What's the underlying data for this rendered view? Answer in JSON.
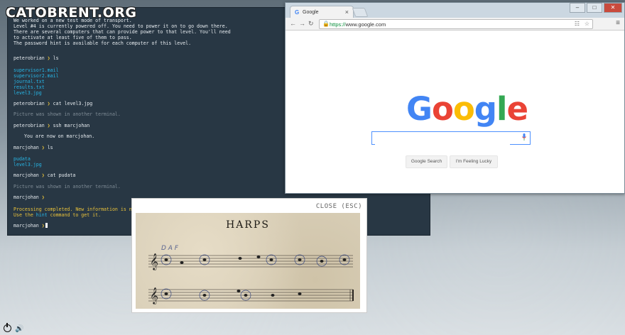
{
  "logo": "CATOBRENT.ORG",
  "terminal": {
    "lines": [
      {
        "text": "We worked on a new test mode of transport.",
        "cls": ""
      },
      {
        "text": "Level #4 is currently powered off. You need to power it on to go down there.",
        "cls": ""
      },
      {
        "text": "There are several computers that can provide power to that level. You'll need",
        "cls": ""
      },
      {
        "text": "to activate at least five of them to pass.",
        "cls": ""
      },
      {
        "text": "The password hint is available for each computer of this level.",
        "cls": ""
      }
    ],
    "prompt1": {
      "user": "peterobrian",
      "cmd": "ls"
    },
    "files1": [
      "supervisor1.mail",
      "supervisor2.mail",
      "journal.txt",
      "results.txt",
      "level3.jpg"
    ],
    "prompt2": {
      "user": "peterobrian",
      "cmd": "cat level3.jpg"
    },
    "msg_shown1": "Picture was shown in another terminal.",
    "prompt3": {
      "user": "peterobrian",
      "cmd": "ssh marcjohan"
    },
    "now_on": "You are now on marcjohan.",
    "prompt4": {
      "user": "marcjohan",
      "cmd": "ls"
    },
    "files2": [
      "pudata",
      "level3.jpg"
    ],
    "prompt5": {
      "user": "marcjohan",
      "cmd": "cat pudata"
    },
    "msg_shown2": "Picture was shown in another terminal.",
    "prompt6": {
      "user": "marcjohan",
      "cmd": ""
    },
    "processing1": "Processing completed. New information is now",
    "processing2a": "Use the ",
    "processing2_hint": "hint",
    "processing2b": " command to get it.",
    "prompt7": {
      "user": "marcjohan",
      "cmd": ""
    },
    "arrow": "❯"
  },
  "browser": {
    "tab_title": "Google",
    "tab_favicon": "G",
    "tab_close": "×",
    "win_min": "–",
    "win_max": "□",
    "win_close": "✕",
    "url_scheme": "https://",
    "url_host": "www.google.com",
    "search_value": "",
    "btn_search": "Google Search",
    "btn_lucky": "I'm Feeling Lucky",
    "logo_letters": [
      {
        "ch": "G",
        "color": "#4285F4"
      },
      {
        "ch": "o",
        "color": "#EA4335"
      },
      {
        "ch": "o",
        "color": "#FBBC05"
      },
      {
        "ch": "g",
        "color": "#4285F4"
      },
      {
        "ch": "l",
        "color": "#34A853"
      },
      {
        "ch": "e",
        "color": "#EA4335"
      }
    ]
  },
  "popup": {
    "close_label": "CLOSE (ESC)",
    "sheet_title": "HARPS",
    "handwritten": "D A F"
  }
}
